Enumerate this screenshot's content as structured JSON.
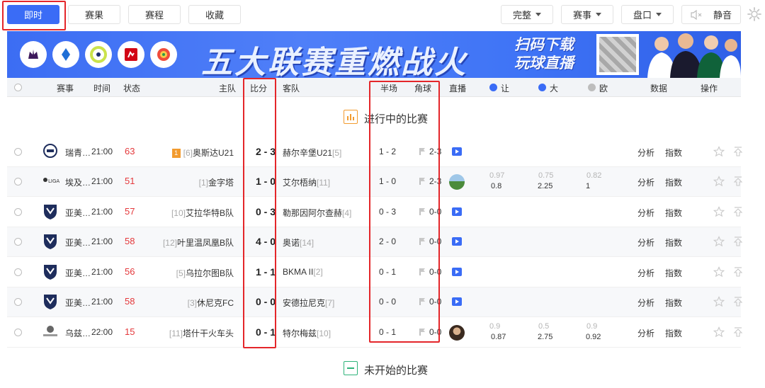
{
  "toolbar": {
    "tabs": [
      {
        "label": "即时",
        "active": true
      },
      {
        "label": "赛果",
        "active": false
      },
      {
        "label": "赛程",
        "active": false
      },
      {
        "label": "收藏",
        "active": false
      }
    ],
    "filters": [
      {
        "label": "完整",
        "icon": "chevron-down-icon"
      },
      {
        "label": "赛事",
        "icon": "chevron-down-icon"
      },
      {
        "label": "盘口",
        "icon": "chevron-down-icon"
      }
    ],
    "sound_label": "静音",
    "sound_icon": "speaker-icon",
    "settings_icon": "gear-icon"
  },
  "banner": {
    "title": "五大联赛重燃战火",
    "subtitle_line1": "扫码下载",
    "subtitle_line2": "玩球直播",
    "league_icons": [
      "premier-league-icon",
      "serie-a-icon",
      "ligue-1-icon",
      "bundesliga-icon",
      "laliga-icon"
    ]
  },
  "header": {
    "league": "赛事",
    "time": "时间",
    "status": "状态",
    "home": "主队",
    "score": "比分",
    "away": "客队",
    "half": "半场",
    "corner": "角球",
    "live": "直播",
    "handicap": "让",
    "over": "大",
    "euro": "欧",
    "data": "数据",
    "actions": "操作"
  },
  "sections": {
    "live": "进行中的比赛",
    "upcoming": "未开始的比赛"
  },
  "matches": [
    {
      "league": "瑞青…",
      "time": "21:00",
      "minute": "63",
      "home_rank": "[6]",
      "home": "奥斯达U21",
      "home_flag": "1",
      "score": "2 - 3",
      "away": "赫尔辛堡U21",
      "away_rank": "[5]",
      "half": "1 - 2",
      "corner": "2-3",
      "live": "video",
      "odds": null,
      "analysis": "分析",
      "index": "指数"
    },
    {
      "league": "埃及…",
      "time": "21:00",
      "minute": "51",
      "home_rank": "[1]",
      "home": "金字塔",
      "home_flag": "",
      "score": "1 - 0",
      "away": "艾尔梧纳",
      "away_rank": "[11]",
      "half": "1 - 0",
      "corner": "2-3",
      "live": "field",
      "odds": {
        "h_top": "0.97",
        "h_bot": "0.8",
        "o_top": "0.75",
        "o_bot": "2.25",
        "e_top": "0.82",
        "e_bot": "1"
      },
      "analysis": "分析",
      "index": "指数"
    },
    {
      "league": "亚美…",
      "time": "21:00",
      "minute": "57",
      "home_rank": "[10]",
      "home": "艾拉华特B队",
      "home_flag": "",
      "score": "0 - 3",
      "away": "勒那因阿尔查赫",
      "away_rank": "[4]",
      "half": "0 - 3",
      "corner": "0-0",
      "live": "video",
      "odds": null,
      "analysis": "分析",
      "index": "指数"
    },
    {
      "league": "亚美…",
      "time": "21:00",
      "minute": "58",
      "home_rank": "[12]",
      "home": "叶里温凤凰B队",
      "home_flag": "",
      "score": "4 - 0",
      "away": "奥诺",
      "away_rank": "[14]",
      "half": "2 - 0",
      "corner": "0-0",
      "live": "video",
      "odds": null,
      "analysis": "分析",
      "index": "指数"
    },
    {
      "league": "亚美…",
      "time": "21:00",
      "minute": "56",
      "home_rank": "[5]",
      "home": "乌拉尔图B队",
      "home_flag": "",
      "score": "1 - 1",
      "away": "BKMA II",
      "away_rank": "[2]",
      "half": "0 - 1",
      "corner": "0-0",
      "live": "video",
      "odds": null,
      "analysis": "分析",
      "index": "指数"
    },
    {
      "league": "亚美…",
      "time": "21:00",
      "minute": "58",
      "home_rank": "[3]",
      "home": "休尼克FC",
      "home_flag": "",
      "score": "0 - 0",
      "away": "安德拉尼克",
      "away_rank": "[7]",
      "half": "0 - 0",
      "corner": "0-0",
      "live": "video",
      "odds": null,
      "analysis": "分析",
      "index": "指数"
    },
    {
      "league": "乌兹…",
      "time": "22:00",
      "minute": "15",
      "home_rank": "[11]",
      "home": "塔什干火车头",
      "home_flag": "",
      "score": "0 - 1",
      "away": "特尔梅兹",
      "away_rank": "[10]",
      "half": "0 - 1",
      "corner": "0-0",
      "live": "avatar",
      "odds": {
        "h_top": "0.9",
        "h_bot": "0.87",
        "o_top": "0.5",
        "o_bot": "2.75",
        "e_top": "0.9",
        "e_bot": "0.92"
      },
      "analysis": "分析",
      "index": "指数"
    }
  ],
  "colors": {
    "accent": "#3a6cf6",
    "highlight": "#e4262a",
    "minute": "#e4393c",
    "live_section": "#f29b2f",
    "upcoming_section": "#2fb37a"
  }
}
